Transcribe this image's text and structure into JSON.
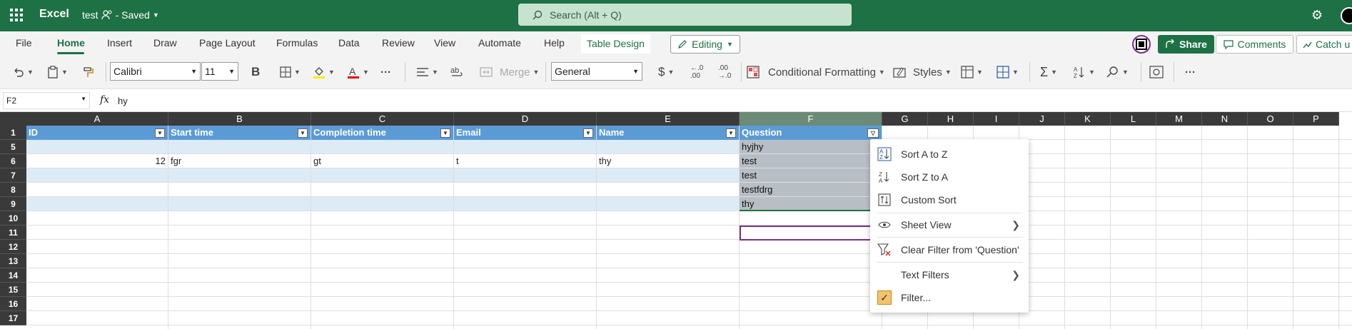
{
  "titlebar": {
    "app_name": "Excel",
    "doc_name": "test",
    "doc_status": "- Saved",
    "search_placeholder": "Search (Alt + Q)"
  },
  "tabs": {
    "items": [
      "File",
      "Home",
      "Insert",
      "Draw",
      "Page Layout",
      "Formulas",
      "Data",
      "Review",
      "View",
      "Automate",
      "Help",
      "Table Design"
    ],
    "active": "Home",
    "editing_label": "Editing",
    "share_label": "Share",
    "comments_label": "Comments",
    "catchup_label": "Catch u"
  },
  "ribbon": {
    "font_name": "Calibri",
    "font_size": "11",
    "bold_label": "B",
    "merge_label": "Merge",
    "number_format": "General",
    "currency_symbol": "$",
    "conditional_formatting_label": "Conditional Formatting",
    "styles_label": "Styles"
  },
  "formula_bar": {
    "name_box": "F2",
    "fx_label": "fx",
    "value": "hy"
  },
  "grid": {
    "columns": [
      "A",
      "B",
      "C",
      "D",
      "E",
      "F",
      "G",
      "H",
      "I",
      "J",
      "K",
      "L",
      "M",
      "N",
      "O",
      "P"
    ],
    "row_numbers": [
      "1",
      "5",
      "6",
      "7",
      "8",
      "9",
      "10",
      "11",
      "12",
      "13",
      "14",
      "15",
      "16",
      "17"
    ],
    "table_headers": [
      "ID",
      "Start time",
      "Completion time",
      "Email",
      "Name",
      "Question"
    ],
    "rows": [
      {
        "row": "5",
        "cells": [
          "",
          "",
          "",
          "",
          "",
          "hyjhy"
        ]
      },
      {
        "row": "6",
        "cells": [
          "12",
          "fgr",
          "gt",
          "t",
          "thy",
          "test"
        ]
      },
      {
        "row": "7",
        "cells": [
          "",
          "",
          "",
          "",
          "",
          "test"
        ]
      },
      {
        "row": "8",
        "cells": [
          "",
          "",
          "",
          "",
          "",
          "testfdrg"
        ]
      },
      {
        "row": "9",
        "cells": [
          "",
          "",
          "",
          "",
          "",
          "thy"
        ]
      }
    ]
  },
  "filter_menu": {
    "items": [
      {
        "label": "Sort A to Z",
        "icon": "sort-az-icon"
      },
      {
        "label": "Sort Z to A",
        "icon": "sort-za-icon"
      },
      {
        "label": "Custom Sort",
        "icon": "custom-sort-icon"
      },
      {
        "label": "Sheet View",
        "icon": "eye-icon",
        "submenu": true
      },
      {
        "label": "Clear Filter from 'Question'",
        "icon": "clear-filter-icon"
      },
      {
        "label": "Text Filters",
        "icon": "",
        "submenu": true
      },
      {
        "label": "Filter...",
        "icon": "checkbox-icon"
      }
    ]
  },
  "colors": {
    "brand_green": "#1e7145",
    "table_header_blue": "#5b9bd5",
    "table_band_blue": "#ddebf7",
    "selection_purple": "#7a2f8f"
  }
}
